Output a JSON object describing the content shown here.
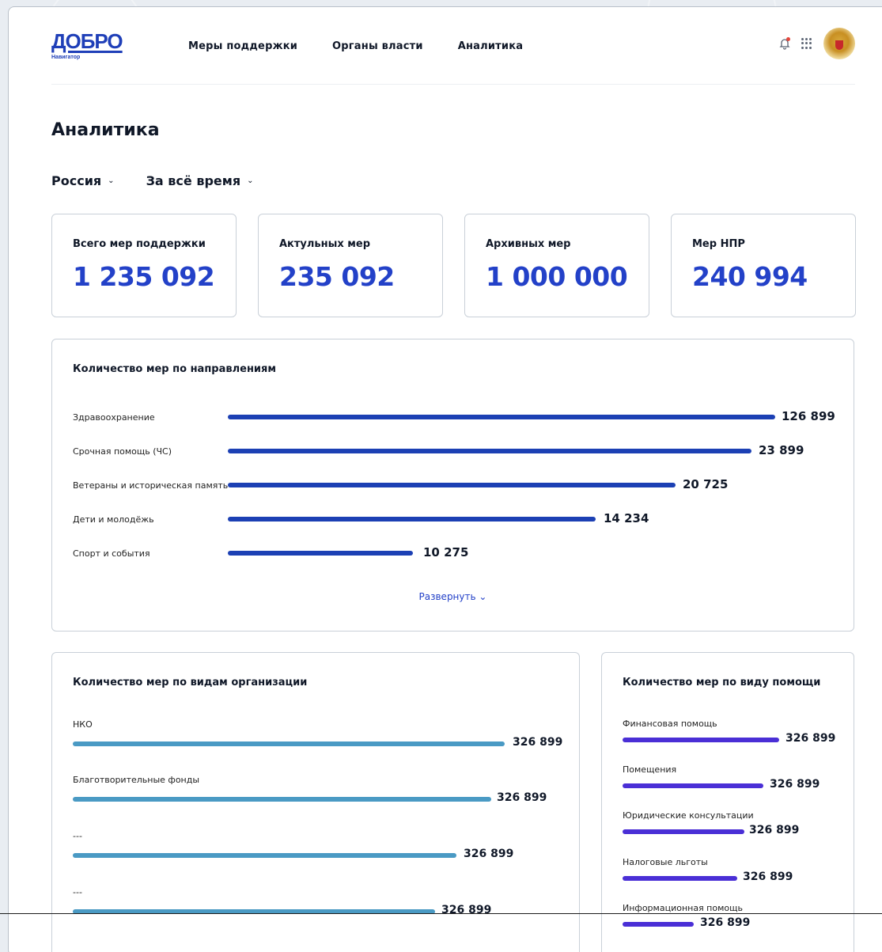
{
  "header": {
    "logo_text": "ДОБРО",
    "logo_subtitle": "Навигатор",
    "nav": [
      "Меры поддержки",
      "Органы власти",
      "Аналитика"
    ]
  },
  "page": {
    "title": "Аналитика",
    "filters": {
      "region": "Россия",
      "period": "За всё время"
    }
  },
  "stats": [
    {
      "label": "Всего мер поддержки",
      "value": "1 235 092"
    },
    {
      "label": "Актульных мер",
      "value": "235 092"
    },
    {
      "label": "Архивных мер",
      "value": "1 000 000"
    },
    {
      "label": "Мер НПР",
      "value": "240 994"
    }
  ],
  "colors": {
    "accent": "#2341c8",
    "directions_bar": "#1c40b4",
    "org_bar": "#4a9ac4",
    "help_bar": "#4a2fd6"
  },
  "directions": {
    "title": "Количество мер по направлениям",
    "expand_label": "Развернуть",
    "items": [
      {
        "label": "Здравоохранение",
        "value": "126 899"
      },
      {
        "label": "Срочная помощь (ЧС)",
        "value": "23 899"
      },
      {
        "label": "Ветераны и историческая память",
        "value": "20 725"
      },
      {
        "label": "Дети и молодёжь",
        "value": "14 234"
      },
      {
        "label": "Спорт и события",
        "value": "10 275"
      }
    ]
  },
  "organizations": {
    "title": "Количество мер по видам организации",
    "items": [
      {
        "label": "НКО",
        "value": "326 899"
      },
      {
        "label": "Благотворительные фонды",
        "value": "326 899"
      },
      {
        "label": "---",
        "value": "326 899"
      },
      {
        "label": "---",
        "value": "326 899"
      }
    ]
  },
  "help_types": {
    "title": "Количество мер по виду помощи",
    "items": [
      {
        "label": "Финансовая помощь",
        "value": "326 899"
      },
      {
        "label": "Помещения",
        "value": "326 899"
      },
      {
        "label": "Юридические консультации",
        "value": "326 899"
      },
      {
        "label": "Налоговые льготы",
        "value": "326 899"
      },
      {
        "label": "Информационная помощь",
        "value": "326 899"
      }
    ]
  }
}
